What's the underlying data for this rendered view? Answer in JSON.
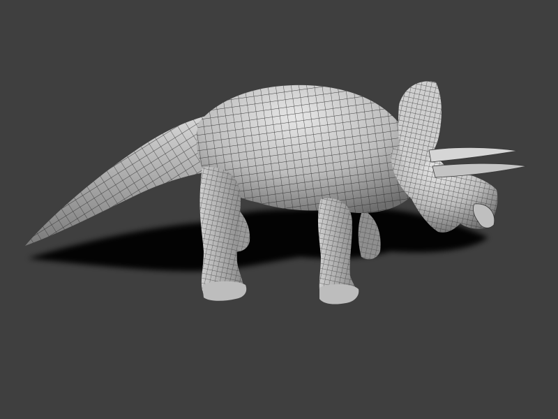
{
  "scene": {
    "subject": "triceratops-wireframe-model",
    "background_color": "#3f3f3f",
    "model_color": "#c9c9c9",
    "shadow_color": "#050505",
    "mesh_line_color": "#222222"
  }
}
